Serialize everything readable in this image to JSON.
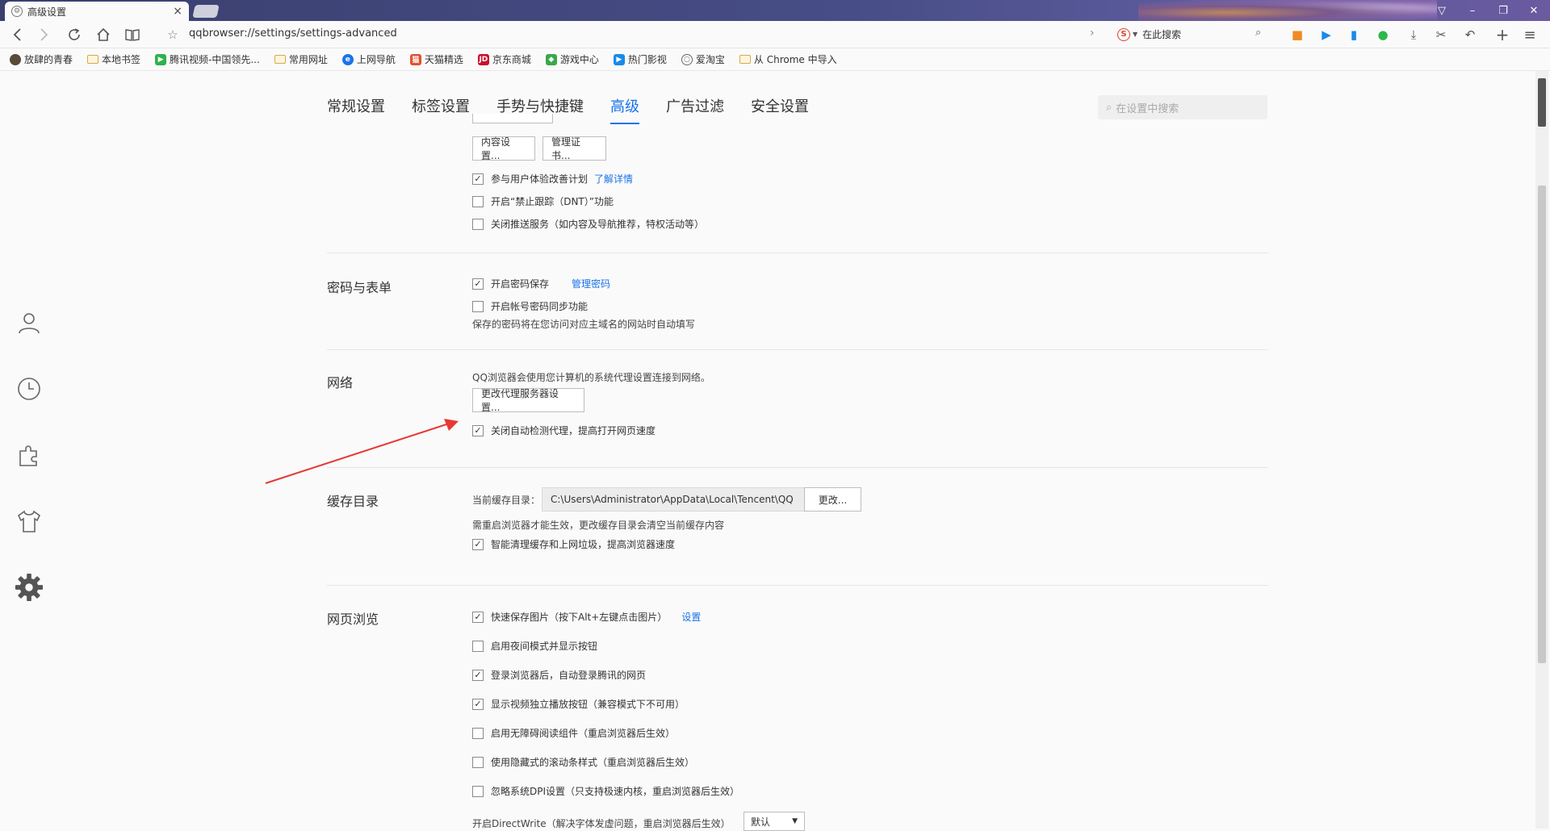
{
  "window": {
    "tab_title": "高级设置",
    "tab_close": "×",
    "controls": [
      "▽",
      "–",
      "❐",
      "✕"
    ]
  },
  "address_bar": {
    "url": "qqbrowser://settings/settings-advanced",
    "search_placeholder": "在此搜索",
    "search_engine_logo": "S"
  },
  "bookmarks": [
    {
      "label": "放肆的青春",
      "icon": "avatar-icon",
      "color": "#5a4a3a"
    },
    {
      "label": "本地书签",
      "icon": "folder-icon"
    },
    {
      "label": "腾讯视频-中国领先...",
      "icon": "tencent-video-icon",
      "color": "#30b050"
    },
    {
      "label": "常用网址",
      "icon": "folder-icon"
    },
    {
      "label": "上网导航",
      "icon": "ie-icon",
      "color": "#1a73e8"
    },
    {
      "label": "天猫精选",
      "icon": "tmall-icon",
      "color": "#e2502e"
    },
    {
      "label": "京东商城",
      "icon": "jd-icon",
      "color": "#c8102e"
    },
    {
      "label": "游戏中心",
      "icon": "gamepad-icon",
      "color": "#3aa84a"
    },
    {
      "label": "热门影视",
      "icon": "play-icon",
      "color": "#1a8ae8"
    },
    {
      "label": "爱淘宝",
      "icon": "globe-icon",
      "color": "#666"
    },
    {
      "label": "从 Chrome 中导入",
      "icon": "folder-icon"
    }
  ],
  "settings": {
    "tabs": [
      {
        "label": "常规设置",
        "active": false
      },
      {
        "label": "标签设置",
        "active": false
      },
      {
        "label": "手势与快捷键",
        "active": false
      },
      {
        "label": "高级",
        "active": true
      },
      {
        "label": "广告过滤",
        "active": false
      },
      {
        "label": "安全设置",
        "active": false
      }
    ],
    "search_placeholder": "在设置中搜索"
  },
  "privacy": {
    "content_settings_btn": "内容设置...",
    "manage_certs_btn": "管理证书...",
    "ux_plan": {
      "label": "参与用户体验改善计划",
      "checked": true,
      "link": "了解详情"
    },
    "dnt": {
      "label": "开启“禁止跟踪（DNT）”功能",
      "checked": false
    },
    "push": {
      "label": "关闭推送服务（如内容及导航推荐，特权活动等）",
      "checked": false
    }
  },
  "password": {
    "title": "密码与表单",
    "save_pw": {
      "label": "开启密码保存",
      "checked": true,
      "link": "管理密码"
    },
    "sync_pw": {
      "label": "开启帐号密码同步功能",
      "checked": false
    },
    "note": "保存的密码将在您访问对应主域名的网站时自动填写"
  },
  "network": {
    "title": "网络",
    "note": "QQ浏览器会使用您计算机的系统代理设置连接到网络。",
    "proxy_btn": "更改代理服务器设置...",
    "auto_proxy": {
      "label": "关闭自动检测代理，提高打开网页速度",
      "checked": true
    }
  },
  "cache": {
    "title": "缓存目录",
    "current_label": "当前缓存目录：",
    "path": "C:\\Users\\Administrator\\AppData\\Local\\Tencent\\QQ",
    "change_btn": "更改...",
    "note": "需重启浏览器才能生效，更改缓存目录会清空当前缓存内容",
    "smart_clean": {
      "label": "智能清理缓存和上网垃圾，提高浏览器速度",
      "checked": true
    }
  },
  "browsing": {
    "title": "网页浏览",
    "items": [
      {
        "label": "快速保存图片（按下Alt+左键点击图片）",
        "checked": true,
        "link": "设置"
      },
      {
        "label": "启用夜间模式并显示按钮",
        "checked": false
      },
      {
        "label": "登录浏览器后，自动登录腾讯的网页",
        "checked": true
      },
      {
        "label": "显示视频独立播放按钮（兼容模式下不可用）",
        "checked": true
      },
      {
        "label": "启用无障碍阅读组件（重启浏览器后生效）",
        "checked": false
      },
      {
        "label": "使用隐藏式的滚动条样式（重启浏览器后生效）",
        "checked": false
      },
      {
        "label": "忽略系统DPI设置（只支持极速内核，重启浏览器后生效）",
        "checked": false
      }
    ],
    "directwrite_label": "开启DirectWrite（解决字体发虚问题，重启浏览器后生效）",
    "directwrite_value": "默认"
  },
  "colors": {
    "accent": "#1a73e8",
    "annotation": "#e53935"
  }
}
